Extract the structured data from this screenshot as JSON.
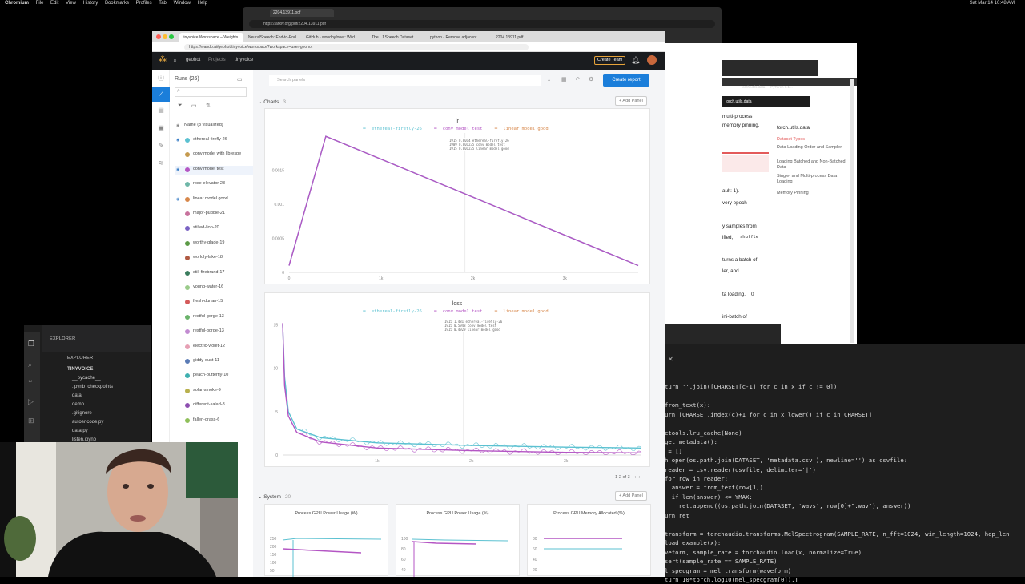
{
  "menubar": {
    "items": [
      "Chromium",
      "File",
      "Edit",
      "View",
      "History",
      "Bookmarks",
      "Profiles",
      "Tab",
      "Window",
      "Help"
    ],
    "clock": "Sat Mar 14 10:48 AM"
  },
  "arxiv_window": {
    "tab_label": "2204.13911.pdf",
    "url": "https://arxiv.org/pdf/2204.13911.pdf"
  },
  "doc_window": {
    "dark_label": "torch.utils.data",
    "texts": [
      "multi-process",
      "memory pinning.",
      "ault: 1).",
      "very epoch",
      "y samples from",
      "ified,",
      "shuffle",
      "turns a batch of",
      "ler, and",
      "ta loading.",
      "0",
      "ini-batch of"
    ],
    "toc_title": "torch.utils.data",
    "toc_items": [
      "Dataset Types",
      "Data Loading Order and Sampler",
      "Loading Batched and Non-Batched Data",
      "Single- and Multi-process Data Loading",
      "Memory Pinning"
    ],
    "small_tab": "torch.utils.data — PyTorch 1.1..."
  },
  "terminal": {
    "lines": [
      "turn ''.join([CHARSET[c-1] for c in x if c != 0])",
      "",
      "from_text(x):",
      "urn [CHARSET.index(c)+1 for c in x.lower() if c in CHARSET]",
      "",
      "ctools.lru_cache(None)",
      "get_metadata():",
      " = []",
      "h open(os.path.join(DATASET, 'metadata.csv'), newline='') as csvfile:",
      "reader = csv.reader(csvfile, delimiter='|')",
      "for row in reader:",
      "  answer = from_text(row[1])",
      "  if len(answer) <= YMAX:",
      "    ret.append((os.path.join(DATASET, 'wavs', row[0]+\".wav\"), answer))",
      "urn ret",
      "",
      "transform = torchaudio.transforms.MelSpectrogram(SAMPLE_RATE, n_fft=1024, win_length=1024, hop_len",
      "load_example(x):",
      "veform, sample_rate = torchaudio.load(x, normalize=True)",
      "sert(sample_rate == SAMPLE_RATE)",
      "l_specgram = mel_transform(waveform)",
      "turn 10*torch.log10(mel_specgram[0]).T"
    ]
  },
  "vscode": {
    "explorer_label": "EXPLORER",
    "explorer_label2": "EXPLORER",
    "project": "TINYVOICE",
    "files": [
      "__pycache__",
      ".ipynb_checkpoints",
      "data",
      "demo",
      ".gitignore",
      "autoencode.py",
      "data.py",
      "listen.ipynb"
    ]
  },
  "wb": {
    "tabs": [
      "tinyvoice Workspace – Weights",
      "NeuralSpeech: End-to-End",
      "GitHub - wondhyfonet: Wild",
      "The LJ Speech Dataset",
      "python - Remove adjacent",
      "2204.13911.pdf"
    ],
    "url": "https://wandb.ai/geohot/tinyvoice/workspace?workspace=user-geohot",
    "nav_user": "geohot",
    "nav_projects": "Projects",
    "nav_project": "tinyvoice",
    "create_team": "Create Team",
    "runs_title": "Runs (26)",
    "name_col": "Name (3 visualized)",
    "runs": [
      {
        "name": "ethereal-firefly-26",
        "color": "#5bc1d1",
        "visible": true
      },
      {
        "name": "conv model with librespe",
        "color": "#c59a4e",
        "visible": false
      },
      {
        "name": "conv model test",
        "color": "#b456c4",
        "visible": true
      },
      {
        "name": "rose-elevator-23",
        "color": "#6fb7a8",
        "visible": false
      },
      {
        "name": "linear model good",
        "color": "#d7874a",
        "visible": true
      },
      {
        "name": "major-puddle-21",
        "color": "#c8729d",
        "visible": false
      },
      {
        "name": "stilted-lion-20",
        "color": "#7a62c4",
        "visible": false
      },
      {
        "name": "worthy-glade-19",
        "color": "#5c9a46",
        "visible": false
      },
      {
        "name": "worldly-lake-18",
        "color": "#b05a43",
        "visible": false
      },
      {
        "name": "still-firebrand-17",
        "color": "#3b7d5e",
        "visible": false
      },
      {
        "name": "young-water-16",
        "color": "#9acb8a",
        "visible": false
      },
      {
        "name": "fresh-durian-15",
        "color": "#d45a5a",
        "visible": false
      },
      {
        "name": "restful-gorge-13",
        "color": "#6bb36b",
        "visible": false
      },
      {
        "name": "restful-gorge-13",
        "color": "#c28bd1",
        "visible": false
      },
      {
        "name": "electric-violet-12",
        "color": "#e6a0b4",
        "visible": false
      },
      {
        "name": "giddy-dust-11",
        "color": "#5a7bb5",
        "visible": false
      },
      {
        "name": "peach-butterfly-10",
        "color": "#3fb0b0",
        "visible": false
      },
      {
        "name": "solar-smoke-9",
        "color": "#b8b04d",
        "visible": false
      },
      {
        "name": "different-salad-8",
        "color": "#8d4fb0",
        "visible": false
      },
      {
        "name": "fallen-grass-6",
        "color": "#8fbf5a",
        "visible": false
      }
    ],
    "search_placeholder": "Search panels",
    "create_report": "Create report",
    "charts_section": "Charts",
    "charts_count": "3",
    "add_panel": "+ Add Panel",
    "system_section": "System",
    "system_count": "20",
    "pager": "1-2 of 3",
    "sys_cards": [
      {
        "title": "Process GPU Power Usage (W)",
        "yticks": [
          "250",
          "200",
          "150",
          "100",
          "50"
        ]
      },
      {
        "title": "Process GPU Power Usage (%)",
        "yticks": [
          "100",
          "80",
          "60",
          "40"
        ]
      },
      {
        "title": "Process GPU Memory Allocated (%)",
        "yticks": [
          "80",
          "60",
          "40",
          "20"
        ]
      }
    ]
  },
  "chart_data": [
    {
      "type": "line",
      "title": "lr",
      "series": [
        {
          "name": "ethereal-firefly-26",
          "color": "#5bc1d1",
          "x": [
            0,
            400,
            3800
          ],
          "y": [
            0.0001,
            0.002,
            0.0001
          ]
        },
        {
          "name": "conv model test",
          "color": "#b456c4",
          "x": [
            0,
            400,
            3800
          ],
          "y": [
            0.0001,
            0.002,
            0.0001
          ]
        },
        {
          "name": "linear model good",
          "color": "#d7874a",
          "x": [],
          "y": []
        }
      ],
      "xticks": [
        "0",
        "1k",
        "2k",
        "3k"
      ],
      "yticks": [
        "0",
        "0.0005",
        "0.001",
        "0.0015"
      ],
      "xlim": [
        0,
        3800
      ],
      "ylim": [
        0,
        0.00205
      ],
      "tooltip": [
        "1915  0.0014  ethereal-firefly-26",
        "1909  0.001235  conv model test",
        "1915  0.001235  linear model good"
      ]
    },
    {
      "type": "line",
      "title": "loss",
      "series": [
        {
          "name": "ethereal-firefly-26",
          "color": "#5bc1d1",
          "x": [
            0,
            20,
            60,
            150,
            400,
            1000,
            2000,
            3000,
            3800
          ],
          "y": [
            15,
            9,
            5,
            3,
            2,
            1.4,
            1.1,
            0.9,
            0.8
          ]
        },
        {
          "name": "conv model test",
          "color": "#b456c4",
          "x": [
            0,
            20,
            60,
            150,
            400,
            1000,
            2000,
            3000,
            3800
          ],
          "y": [
            15.2,
            8,
            4.5,
            2.6,
            1.5,
            0.8,
            0.5,
            0.3,
            0.25
          ]
        },
        {
          "name": "linear model good",
          "color": "#d7874a",
          "x": [],
          "y": []
        }
      ],
      "xticks": [
        "1k",
        "2k",
        "3k"
      ],
      "yticks": [
        "0",
        "5",
        "10",
        "15"
      ],
      "xlim": [
        0,
        3800
      ],
      "ylim": [
        0,
        15.5
      ],
      "tooltip": [
        "1915  1.481  ethereal-firefly-26",
        "1915  0.5948  conv model test",
        "1915  0.4929  linear model good"
      ]
    }
  ]
}
